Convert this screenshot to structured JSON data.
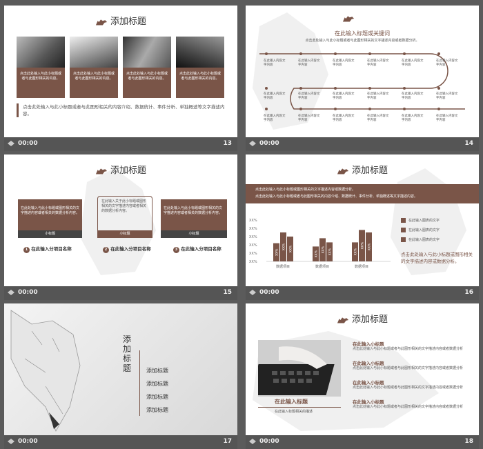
{
  "slides": [
    {
      "num": "13",
      "time": "00:00",
      "title": "添加标题",
      "cards": [
        "点击此处输入与此小标题或者与此图形相关的内容。",
        "点击此处输入与此小标题或者与此图形相关的内容。",
        "点击此处输入与此小标题或者与此图形相关的内容。",
        "点击此处输入与此小标题或者与此图形相关的内容。"
      ],
      "body": "点击此处输入与此小标题或者与此图形相关的内容介绍、数据统计、事件分析、单独概述等文字描述内容。"
    },
    {
      "num": "14",
      "time": "00:00",
      "heading": "在此输入标题或关键词",
      "subheading": "点击此处输入与此小标题或者与此图形相关的文字描述内容或者数据分析。",
      "node_text": "在此输入内容文字内容",
      "rows": 3,
      "cols": 6
    },
    {
      "num": "15",
      "time": "00:00",
      "title": "添加标题",
      "box_text": "在此处输入与此小标题或图形相关的文字描述内容或者相关的数据分析内容。",
      "mid_text": "在此输入关于此小标题或图形相关的文字描述内容或者相关的数据分析内容。",
      "tag": "小标题",
      "items": [
        "在此输入分项目名称",
        "在此输入分项目名称",
        "在此输入分项目名称"
      ],
      "badges": [
        "1",
        "2",
        "3"
      ]
    },
    {
      "num": "16",
      "time": "00:00",
      "title": "添加标题",
      "banner1": "点击此处输入与此小标题或图形相关的文字描述内容或数据分析。",
      "banner2": "点击此处输入与此小标题或者与此图形相关的内容介绍、数据统计、事件分析、单独概述等文字描述内容。",
      "legend": [
        "在此输入图表的文字",
        "在此输入图表的文字",
        "在此输入图表的文字"
      ],
      "note": "点击此处输入与此小标题或图形相关的文字描述内容或数据分析。"
    },
    {
      "num": "17",
      "time": "00:00",
      "vtitle": "添加标题",
      "toc": [
        "添加标题",
        "添加标题",
        "添加标题",
        "添加标题"
      ]
    },
    {
      "num": "18",
      "time": "00:00",
      "title": "添加标题",
      "caption": "在此输入标题",
      "caption_sub": "在此输入标题相关的描述",
      "points": [
        {
          "h": "在此输入小标题",
          "t": "点击此处输入与此小标题或者与此图形相关的文字描述内容或者数据分析"
        },
        {
          "h": "在此输入小标题",
          "t": "点击此处输入与此小标题或者与此图形相关的文字描述内容或者数据分析"
        },
        {
          "h": "在此输入小标题",
          "t": "点击此处输入与此小标题或者与此图形相关的文字描述内容或者数据分析"
        },
        {
          "h": "在此输入小标题",
          "t": "点击此处输入与此小标题或者与此图形相关的文字描述内容或者数据分析"
        }
      ]
    }
  ],
  "chart_data": {
    "type": "bar",
    "categories": [
      "数据项目",
      "数据项目",
      "数据项目"
    ],
    "series": [
      {
        "values": [
          2.2,
          1.8,
          2.3
        ]
      },
      {
        "values": [
          3.5,
          2.8,
          3.8
        ]
      },
      {
        "values": [
          3.0,
          2.3,
          3.5
        ]
      }
    ],
    "yticks": [
      "XX%",
      "XX%",
      "XX%",
      "XX%",
      "XX%",
      "XX%"
    ],
    "bar_label": "XX%",
    "ylim": [
      0,
      5
    ]
  },
  "colors": {
    "accent": "#7a5548",
    "frame": "#5b5b5b"
  }
}
